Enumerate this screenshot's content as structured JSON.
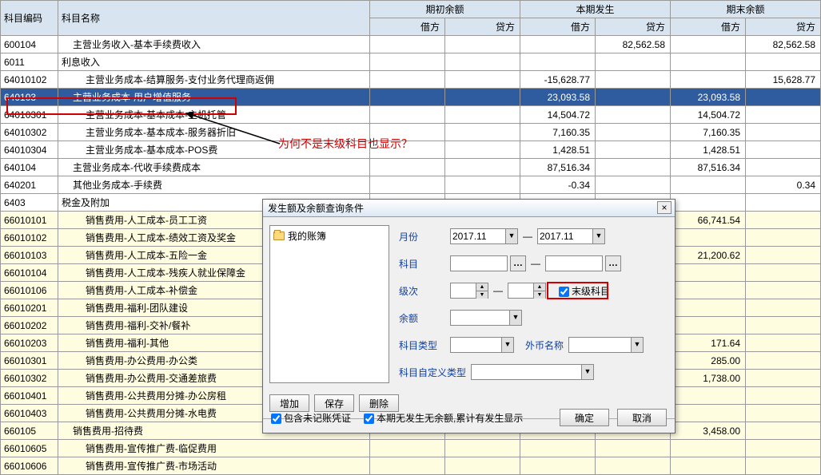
{
  "headers": {
    "code": "科目编码",
    "name": "科目名称",
    "period_begin": "期初余额",
    "period_occur": "本期发生",
    "period_end": "期末余额",
    "debit": "借方",
    "credit": "贷方"
  },
  "rows": [
    {
      "code": "600104",
      "name": "主营业务收入-基本手续费收入",
      "indent": 1,
      "cls": "",
      "d1": "",
      "c1": "",
      "d2": "",
      "c2": "82,562.58",
      "d3": "",
      "c3": "82,562.58"
    },
    {
      "code": "6011",
      "name": "利息收入",
      "indent": 0,
      "cls": "",
      "d1": "",
      "c1": "",
      "d2": "",
      "c2": "",
      "d3": "",
      "c3": ""
    },
    {
      "code": "64010102",
      "name": "主营业务成本-结算服务-支付业务代理商返佣",
      "indent": 2,
      "cls": "",
      "d1": "",
      "c1": "",
      "d2": "-15,628.77",
      "c2": "",
      "d3": "",
      "c3": "15,628.77"
    },
    {
      "code": "640103",
      "name": "主营业务成本-用户增值服务",
      "indent": 1,
      "cls": "selected",
      "d1": "",
      "c1": "",
      "d2": "23,093.58",
      "c2": "",
      "d3": "23,093.58",
      "c3": ""
    },
    {
      "code": "64010301",
      "name": "主营业务成本-基本成本-主机托管",
      "indent": 2,
      "cls": "",
      "d1": "",
      "c1": "",
      "d2": "14,504.72",
      "c2": "",
      "d3": "14,504.72",
      "c3": ""
    },
    {
      "code": "64010302",
      "name": "主营业务成本-基本成本-服务器折旧",
      "indent": 2,
      "cls": "",
      "d1": "",
      "c1": "",
      "d2": "7,160.35",
      "c2": "",
      "d3": "7,160.35",
      "c3": ""
    },
    {
      "code": "64010304",
      "name": "主营业务成本-基本成本-POS费",
      "indent": 2,
      "cls": "",
      "d1": "",
      "c1": "",
      "d2": "1,428.51",
      "c2": "",
      "d3": "1,428.51",
      "c3": ""
    },
    {
      "code": "640104",
      "name": "主营业务成本-代收手续费成本",
      "indent": 1,
      "cls": "",
      "d1": "",
      "c1": "",
      "d2": "87,516.34",
      "c2": "",
      "d3": "87,516.34",
      "c3": ""
    },
    {
      "code": "640201",
      "name": "其他业务成本-手续费",
      "indent": 1,
      "cls": "",
      "d1": "",
      "c1": "",
      "d2": "-0.34",
      "c2": "",
      "d3": "",
      "c3": "0.34"
    },
    {
      "code": "6403",
      "name": "税金及附加",
      "indent": 0,
      "cls": "",
      "d1": "",
      "c1": "",
      "d2": "",
      "c2": "",
      "d3": "",
      "c3": ""
    },
    {
      "code": "66010101",
      "name": "销售费用-人工成本-员工工资",
      "indent": 2,
      "cls": "yellow",
      "d1": "",
      "c1": "",
      "d2": "",
      "c2": "",
      "d3": "66,741.54",
      "c3": ""
    },
    {
      "code": "66010102",
      "name": "销售费用-人工成本-绩效工资及奖金",
      "indent": 2,
      "cls": "yellow",
      "d1": "",
      "c1": "",
      "d2": "",
      "c2": "",
      "d3": "",
      "c3": ""
    },
    {
      "code": "66010103",
      "name": "销售费用-人工成本-五险一金",
      "indent": 2,
      "cls": "yellow",
      "d1": "",
      "c1": "",
      "d2": "",
      "c2": "",
      "d3": "21,200.62",
      "c3": ""
    },
    {
      "code": "66010104",
      "name": "销售费用-人工成本-残疾人就业保障金",
      "indent": 2,
      "cls": "yellow",
      "d1": "",
      "c1": "",
      "d2": "",
      "c2": "",
      "d3": "",
      "c3": ""
    },
    {
      "code": "66010106",
      "name": "销售费用-人工成本-补偿金",
      "indent": 2,
      "cls": "yellow",
      "d1": "",
      "c1": "",
      "d2": "",
      "c2": "",
      "d3": "",
      "c3": ""
    },
    {
      "code": "66010201",
      "name": "销售费用-福利-团队建设",
      "indent": 2,
      "cls": "yellow",
      "d1": "",
      "c1": "",
      "d2": "",
      "c2": "",
      "d3": "",
      "c3": ""
    },
    {
      "code": "66010202",
      "name": "销售费用-福利-交补/餐补",
      "indent": 2,
      "cls": "yellow",
      "d1": "",
      "c1": "",
      "d2": "",
      "c2": "",
      "d3": "",
      "c3": ""
    },
    {
      "code": "66010203",
      "name": "销售费用-福利-其他",
      "indent": 2,
      "cls": "yellow",
      "d1": "",
      "c1": "",
      "d2": "",
      "c2": "",
      "d3": "171.64",
      "c3": ""
    },
    {
      "code": "66010301",
      "name": "销售费用-办公费用-办公类",
      "indent": 2,
      "cls": "yellow",
      "d1": "",
      "c1": "",
      "d2": "",
      "c2": "",
      "d3": "285.00",
      "c3": ""
    },
    {
      "code": "66010302",
      "name": "销售费用-办公费用-交通差旅费",
      "indent": 2,
      "cls": "yellow",
      "d1": "",
      "c1": "",
      "d2": "",
      "c2": "",
      "d3": "1,738.00",
      "c3": ""
    },
    {
      "code": "66010401",
      "name": "销售费用-公共费用分摊-办公房租",
      "indent": 2,
      "cls": "yellow",
      "d1": "",
      "c1": "",
      "d2": "",
      "c2": "",
      "d3": "",
      "c3": ""
    },
    {
      "code": "66010403",
      "name": "销售费用-公共费用分摊-水电费",
      "indent": 2,
      "cls": "yellow",
      "d1": "",
      "c1": "",
      "d2": "",
      "c2": "",
      "d3": "",
      "c3": ""
    },
    {
      "code": "660105",
      "name": "销售费用-招待费",
      "indent": 1,
      "cls": "yellow",
      "d1": "",
      "c1": "",
      "d2": "",
      "c2": "",
      "d3": "3,458.00",
      "c3": ""
    },
    {
      "code": "66010605",
      "name": "销售费用-宣传推广费-临促费用",
      "indent": 2,
      "cls": "yellow",
      "d1": "",
      "c1": "",
      "d2": "",
      "c2": "",
      "d3": "",
      "c3": ""
    },
    {
      "code": "66010606",
      "name": "销售费用-宣传推广费-市场活动",
      "indent": 2,
      "cls": "yellow",
      "d1": "",
      "c1": "",
      "d2": "",
      "c2": "",
      "d3": "",
      "c3": ""
    }
  ],
  "annotation": "为何不是末级科目也显示？",
  "dialog": {
    "title": "发生额及余额查询条件",
    "close": "×",
    "folder": "我的账簿",
    "labels": {
      "month": "月份",
      "subject": "科目",
      "level": "级次",
      "leaf": "末级科目",
      "balance": "余额",
      "subject_type": "科目类型",
      "currency": "外币名称",
      "custom_type": "科目自定义类型"
    },
    "month_from": "2017.11",
    "month_to": "2017.11",
    "dash": "—",
    "dots": "…",
    "btn_add": "增加",
    "btn_save": "保存",
    "btn_delete": "删除",
    "chk_unposted": "包含未记账凭证",
    "chk_nobalance": "本期无发生无余额,累计有发生显示",
    "btn_ok": "确定",
    "btn_cancel": "取消"
  }
}
